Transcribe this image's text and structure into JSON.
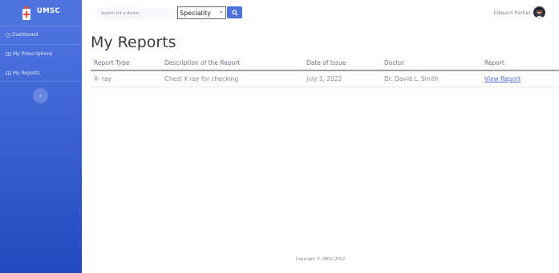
{
  "brand": {
    "name": "UMSC"
  },
  "sidebar": {
    "items": [
      {
        "label": "Dashboard",
        "icon": "dashboard-icon"
      },
      {
        "label": "My Prescriptions",
        "icon": "table-icon"
      },
      {
        "label": "My Reports",
        "icon": "table-icon"
      }
    ],
    "toggle_icon": "chevron-left-icon"
  },
  "topbar": {
    "search_placeholder": "Search for a doctor",
    "speciality_selected": "Speciality",
    "search_button_icon": "search-icon",
    "user_name": "Edward Parker"
  },
  "main": {
    "title": "My Reports",
    "columns": [
      "Report Type",
      "Description of the Report",
      "Date of Issue",
      "Doctor",
      "Report"
    ],
    "rows": [
      {
        "type": "X- ray",
        "description": "Chest X ray for checking",
        "date": "July 1, 2022",
        "doctor": "Dr. David L. Smith",
        "link": "View Report"
      }
    ]
  },
  "footer": {
    "text": "Copyright © UMSC 2022"
  },
  "colors": {
    "accent": "#4e73df",
    "sidebar_gradient_end": "#224abe"
  }
}
